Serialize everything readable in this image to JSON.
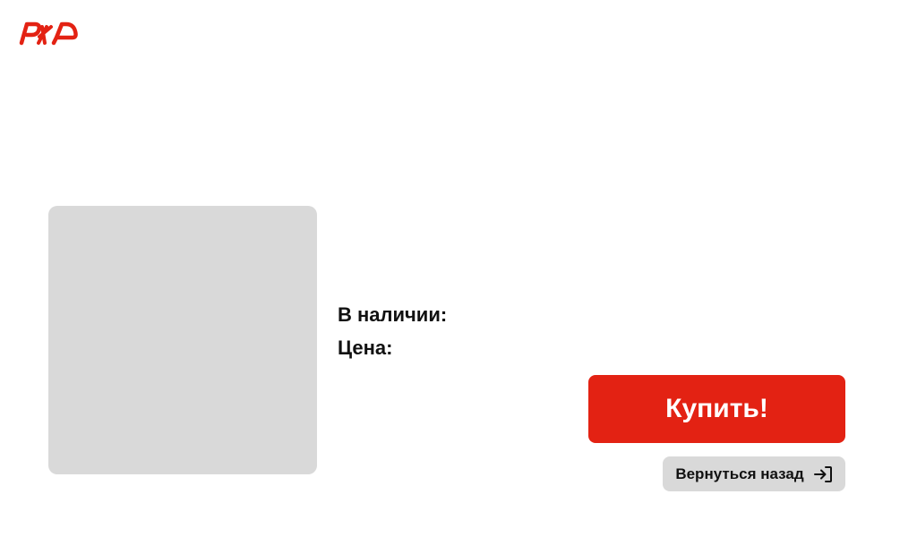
{
  "header": {
    "logo_text": "РЖД",
    "brand_color": "#e32213"
  },
  "product": {
    "image_placeholder_color": "#d9d9d9",
    "availability_label": "В наличии:",
    "price_label": "Цена:"
  },
  "actions": {
    "buy_label": "Купить!",
    "back_label": "Вернуться назад",
    "back_icon": "sign-in-arrow-icon"
  }
}
